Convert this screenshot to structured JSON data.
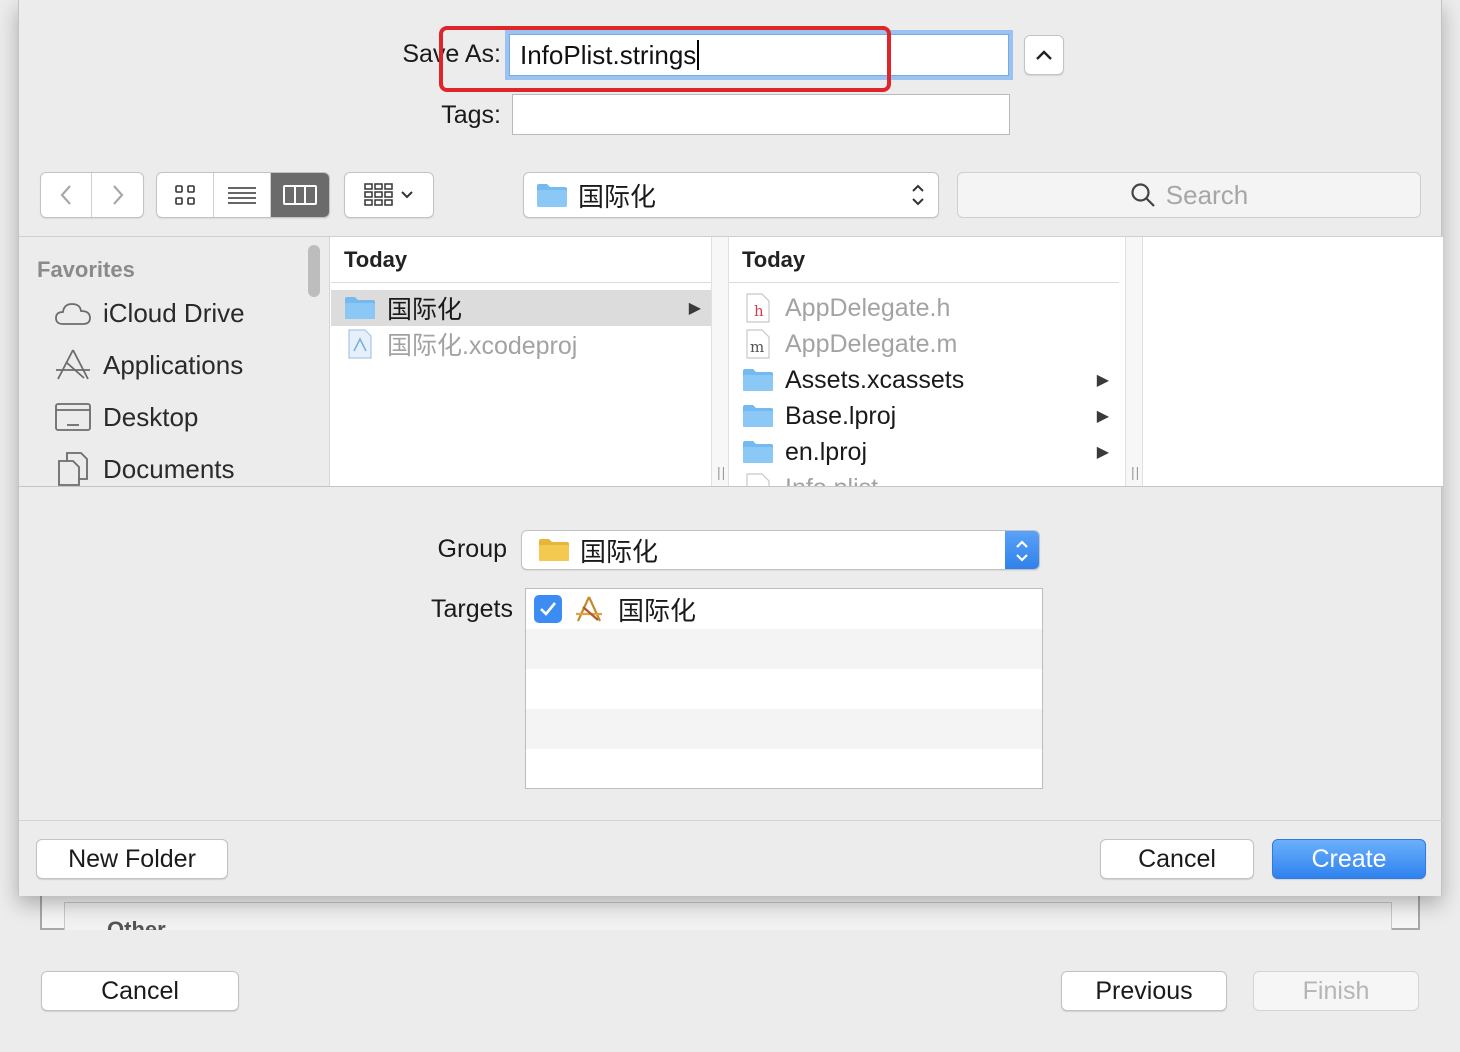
{
  "save": {
    "save_as_label": "Save As:",
    "filename": "InfoPlist.strings",
    "tags_label": "Tags:",
    "tags_value": ""
  },
  "toolbar": {
    "location": "国际化",
    "search_placeholder": "Search",
    "active_view": "column"
  },
  "sidebar": {
    "header": "Favorites",
    "items": [
      {
        "label": "iCloud Drive",
        "icon": "cloud-icon"
      },
      {
        "label": "Applications",
        "icon": "applications-icon"
      },
      {
        "label": "Desktop",
        "icon": "desktop-icon"
      },
      {
        "label": "Documents",
        "icon": "documents-icon"
      }
    ]
  },
  "columns": [
    {
      "header": "Today",
      "rows": [
        {
          "label": "国际化",
          "type": "folder",
          "selected": true,
          "has_children": true
        },
        {
          "label": "国际化.xcodeproj",
          "type": "xcodeproj",
          "dimmed": true
        }
      ]
    },
    {
      "header": "Today",
      "rows": [
        {
          "label": "AppDelegate.h",
          "type": "h-file",
          "dimmed": true
        },
        {
          "label": "AppDelegate.m",
          "type": "m-file",
          "dimmed": true
        },
        {
          "label": "Assets.xcassets",
          "type": "folder",
          "has_children": true
        },
        {
          "label": "Base.lproj",
          "type": "folder",
          "has_children": true
        },
        {
          "label": "en.lproj",
          "type": "folder",
          "has_children": true
        },
        {
          "label": "Info.plist",
          "type": "plist",
          "dimmed": true
        }
      ]
    }
  ],
  "options": {
    "group_label": "Group",
    "group_value": "国际化",
    "targets_label": "Targets",
    "targets": [
      {
        "label": "国际化",
        "checked": true
      }
    ]
  },
  "buttons": {
    "new_folder": "New Folder",
    "cancel": "Cancel",
    "create": "Create"
  },
  "wizard": {
    "section_label": "Other",
    "cancel": "Cancel",
    "previous": "Previous",
    "finish": "Finish"
  },
  "colors": {
    "accent": "#3d8cf3",
    "highlight": "#e0252a",
    "folder": "#74b9f0",
    "group_folder": "#f3c94f"
  }
}
